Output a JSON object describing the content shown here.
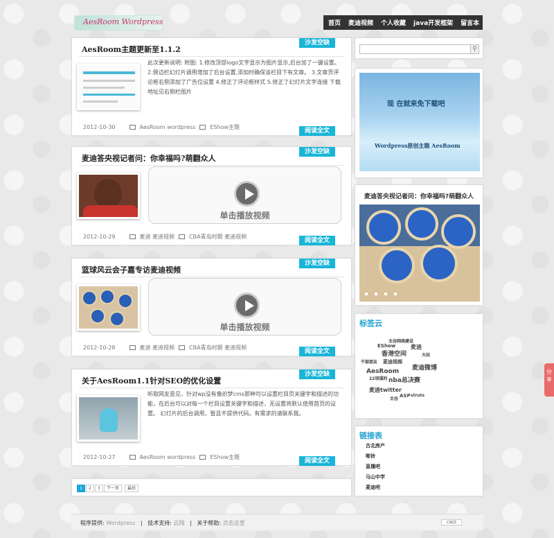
{
  "site": {
    "logo_text": "AesRoom Wordpress"
  },
  "nav": [
    "首页",
    "麦迪视频",
    "个人收藏",
    "java开发框架",
    "留言本"
  ],
  "badges": {
    "sofa": "沙发空缺",
    "read_more": "阅读全文"
  },
  "posts": [
    {
      "title": "AesRoom主题更新至1.1.2",
      "excerpt": "此次更新说明: 附图: 1.修改顶部logo文字显示为图片显示,后台加了一键设置。 2.侧边栏幻灯片调用增加了后台设置,添加时确保该栏目下有文章。 3.文章页评论框右侧添加了广告位设置 4.修正了评论框样式 5.修正了幻灯片文字连接 下载地址见右侧栏图片",
      "date": "2012-10-30",
      "tags": "AesRoom wordpress",
      "category": "EShow主题"
    },
    {
      "title": "麦迪答央视记者问：你幸福吗?萌翻众人",
      "date": "2012-10-29",
      "tags": "麦迪 麦迪视频",
      "category": "CBA青岛时期 麦迪视频",
      "video_label": "单击播放视频"
    },
    {
      "title": "篮球风云会子嘉专访麦迪视频",
      "date": "2012-10-28",
      "tags": "麦迪 麦迪视频",
      "category": "CBA青岛时期 麦迪视频",
      "video_label": "单击播放视频"
    },
    {
      "title": "关于AesRoom1.1针对SEO的优化设置",
      "excerpt": "听取网友意见，针对wp没有像织梦cms那种可以设置栏目页关键字和描述的功能，在后台可以对每一个栏目设置关键字和描述，无设置将默认使用首页的设置。 幻灯片的后台调用，暂且不提供代码。有需求的请联系我。",
      "date": "2012-10-27",
      "tags": "AesRoom wordpress",
      "category": "EShow主题"
    }
  ],
  "pager": [
    "1",
    "2",
    "3",
    "下一页",
    "最后"
  ],
  "sidebar": {
    "ad_line1": "现 在就来免下载吧",
    "ad_line2": "Wordpress原创主题 AesRoom",
    "slider_title": "麦迪答央视记者问：你幸福吗?萌翻众人",
    "tags_title": "标签云",
    "tags": [
      "太谷网络建设",
      "EShow",
      "麦迪",
      "香港空间",
      "大站",
      "麦迪视频",
      "干部朋友",
      "麦迪微博",
      "AesRoom",
      "22项福利",
      "nba总决赛",
      "麦迪twitter",
      "ASP",
      "struts",
      "太谷"
    ],
    "links_title": "链接表",
    "links": [
      "古北房产",
      "嘭铃",
      "直播吧",
      "马山中学",
      "麦迪吧"
    ]
  },
  "footer": {
    "program_label": "程序提供:",
    "program_value": "Wordpress",
    "support_label": "技术支持:",
    "support_value": "远翔",
    "help_label": "关于帮助:",
    "help_value": "点击这里",
    "flag": "CNZZ"
  },
  "share": {
    "label": "分享"
  },
  "colors": {
    "accent": "#19b5d8",
    "nav_bg": "#333333",
    "share": "#e96a6a"
  }
}
